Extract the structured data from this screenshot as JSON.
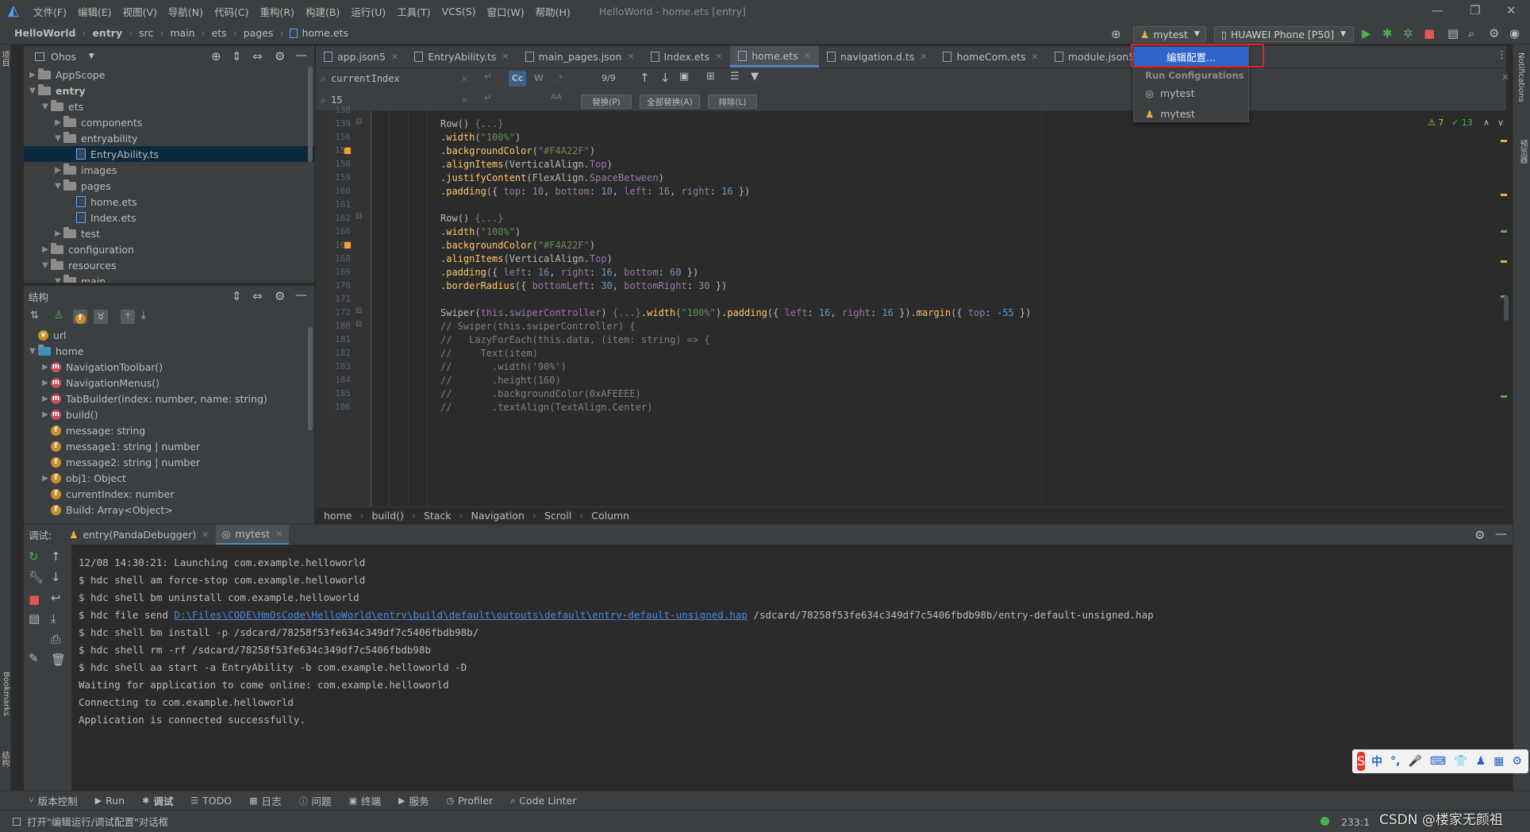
{
  "window": {
    "menus": [
      "文件(F)",
      "编辑(E)",
      "视图(V)",
      "导航(N)",
      "代码(C)",
      "重构(R)",
      "构建(B)",
      "运行(U)",
      "工具(T)",
      "VCS(S)",
      "窗口(W)",
      "帮助(H)"
    ],
    "title": "HelloWorld - home.ets [entry]"
  },
  "navbar": {
    "crumbs": [
      "HelloWorld",
      "entry",
      "src",
      "main",
      "ets",
      "pages",
      "home.ets"
    ],
    "run_config": "mytest",
    "device": "HUAWEI Phone [P50]"
  },
  "project": {
    "header": "Ohos",
    "tree": [
      {
        "label": "AppScope",
        "indent": 0,
        "kind": "folder",
        "open": false
      },
      {
        "label": "entry",
        "indent": 0,
        "kind": "folder",
        "open": true,
        "bold": true
      },
      {
        "label": "ets",
        "indent": 1,
        "kind": "folder",
        "open": true
      },
      {
        "label": "components",
        "indent": 2,
        "kind": "folder",
        "open": false
      },
      {
        "label": "entryability",
        "indent": 2,
        "kind": "folder",
        "open": true
      },
      {
        "label": "EntryAbility.ts",
        "indent": 3,
        "kind": "file",
        "selected": true
      },
      {
        "label": "images",
        "indent": 2,
        "kind": "folder",
        "open": false
      },
      {
        "label": "pages",
        "indent": 2,
        "kind": "folder",
        "open": true
      },
      {
        "label": "home.ets",
        "indent": 3,
        "kind": "file"
      },
      {
        "label": "Index.ets",
        "indent": 3,
        "kind": "file"
      },
      {
        "label": "test",
        "indent": 2,
        "kind": "folder",
        "open": false
      },
      {
        "label": "configuration",
        "indent": 1,
        "kind": "folder",
        "open": false
      },
      {
        "label": "resources",
        "indent": 1,
        "kind": "folder",
        "open": true
      },
      {
        "label": "main",
        "indent": 2,
        "kind": "folder",
        "open": true
      }
    ]
  },
  "structure": {
    "header": "结构",
    "tree": [
      {
        "label": "url",
        "indent": 0,
        "icon": "v",
        "arrow": false
      },
      {
        "label": "home",
        "indent": 0,
        "icon": "class",
        "arrow": true,
        "open": true
      },
      {
        "label": "NavigationToolbar()",
        "indent": 1,
        "icon": "m",
        "arrow": true
      },
      {
        "label": "NavigationMenus()",
        "indent": 1,
        "icon": "m",
        "arrow": true
      },
      {
        "label": "TabBuilder(index: number, name: string)",
        "indent": 1,
        "icon": "m",
        "arrow": true
      },
      {
        "label": "build()",
        "indent": 1,
        "icon": "m",
        "arrow": true
      },
      {
        "label": "message: string",
        "indent": 1,
        "icon": "f",
        "arrow": false
      },
      {
        "label": "message1: string | number",
        "indent": 1,
        "icon": "f",
        "arrow": false
      },
      {
        "label": "message2: string | number",
        "indent": 1,
        "icon": "f",
        "arrow": false
      },
      {
        "label": "obj1: Object",
        "indent": 1,
        "icon": "f",
        "arrow": true
      },
      {
        "label": "currentIndex: number",
        "indent": 1,
        "icon": "f",
        "arrow": false
      },
      {
        "label": "Build: Array<Object>",
        "indent": 1,
        "icon": "f",
        "arrow": false
      }
    ]
  },
  "tabs": [
    {
      "label": "app.json5"
    },
    {
      "label": "EntryAbility.ts"
    },
    {
      "label": "main_pages.json"
    },
    {
      "label": "Index.ets"
    },
    {
      "label": "home.ets",
      "active": true
    },
    {
      "label": "navigation.d.ts"
    },
    {
      "label": "homeCom.ets"
    },
    {
      "label": "module.json5"
    }
  ],
  "find": {
    "search_value": "currentIndex",
    "count": "9/9",
    "replace_value": "15",
    "cc": "Cc",
    "w": "W",
    "regex": ".*",
    "aa": "AA",
    "btn_replace": "替换(P)",
    "btn_replace_all": "全部替换(A)",
    "btn_exclude": "排除(L)"
  },
  "editor": {
    "warnings": "7",
    "weak_warnings": "13",
    "lines": [
      {
        "n": "138",
        "html": ""
      },
      {
        "n": "139",
        "html": "<span class='ty'>Row</span>() <span class='cmt'>{...}</span>"
      },
      {
        "n": "156",
        "html": "<span class='fn'>.width</span>(<span class='str'>\"100%\"</span>)"
      },
      {
        "n": "157",
        "html": "<span class='fn'>.backgroundColor</span>(<span class='str'>\"#F4A22F\"</span>)"
      },
      {
        "n": "158",
        "html": "<span class='fn'>.alignItems</span>(<span class='ty'>VerticalAlign</span>.<span class='prop'>Top</span>)"
      },
      {
        "n": "159",
        "html": "<span class='fn'>.justifyContent</span>(<span class='ty'>FlexAlign</span>.<span class='prop'>SpaceBetween</span>)"
      },
      {
        "n": "160",
        "html": "<span class='fn'>.padding</span>({ <span class='prop'>top</span>: <span class='num'>10</span>, <span class='prop'>bottom</span>: <span class='num'>10</span>, <span class='prop'>left</span>: <span class='num'>16</span>, <span class='prop'>right</span>: <span class='num'>16</span> })"
      },
      {
        "n": "161",
        "html": ""
      },
      {
        "n": "162",
        "html": "<span class='ty'>Row</span>() <span class='cmt'>{...}</span>"
      },
      {
        "n": "166",
        "html": "<span class='fn'>.width</span>(<span class='str'>\"100%\"</span>)"
      },
      {
        "n": "167",
        "html": "<span class='fn'>.backgroundColor</span>(<span class='str'>\"#F4A22F\"</span>)"
      },
      {
        "n": "168",
        "html": "<span class='fn'>.alignItems</span>(<span class='ty'>VerticalAlign</span>.<span class='prop'>Top</span>)"
      },
      {
        "n": "169",
        "html": "<span class='fn'>.padding</span>({ <span class='prop'>left</span>: <span class='num'>16</span>, <span class='prop'>right</span>: <span class='num'>16</span>, <span class='prop'>bottom</span>: <span class='num'>60</span> })"
      },
      {
        "n": "170",
        "html": "<span class='fn'>.borderRadius</span>({ <span class='prop'>bottomLeft</span>: <span class='num'>30</span>, <span class='prop'>bottomRight</span>: <span class='num'>30</span> })"
      },
      {
        "n": "171",
        "html": ""
      },
      {
        "n": "172",
        "html": "<span class='ty'>Swiper</span>(<span class='prop'>this</span>.<span class='prop'>swiperController</span>) <span class='cmt'>{...}</span><span class='fn'>.width</span>(<span class='str'>\"100%\"</span>)<span class='fn'>.padding</span>({ <span class='prop'>left</span>: <span class='num'>16</span>, <span class='prop'>right</span>: <span class='num'>16</span> })<span class='fn'>.margin</span>({ <span class='prop'>top</span>: <span class='num'>-55</span> })"
      },
      {
        "n": "180",
        "html": "<span class='cmt'>// Swiper(this.swiperController) {</span>"
      },
      {
        "n": "181",
        "html": "<span class='cmt'>//   LazyForEach(this.data, (item: string) =&gt; {</span>"
      },
      {
        "n": "182",
        "html": "<span class='cmt'>//     Text(item)</span>"
      },
      {
        "n": "183",
        "html": "<span class='cmt'>//       .width('90%')</span>"
      },
      {
        "n": "184",
        "html": "<span class='cmt'>//       .height(160)</span>"
      },
      {
        "n": "185",
        "html": "<span class='cmt'>//       .backgroundColor(0xAFEEEE)</span>"
      },
      {
        "n": "186",
        "html": "<span class='cmt'>//       .textAlign(TextAlign.Center)</span>"
      }
    ],
    "breadcrumbs": [
      "home",
      "build()",
      "Stack",
      "Navigation",
      "Scroll",
      "Column"
    ]
  },
  "debug": {
    "label": "调试:",
    "tabs": [
      {
        "label": "entry(PandaDebugger)"
      },
      {
        "label": "mytest",
        "active": true
      }
    ],
    "console": [
      "12/08 14:30:21: Launching com.example.helloworld",
      "$ hdc shell am force-stop com.example.helloworld",
      "$ hdc shell bm uninstall com.example.helloworld",
      {
        "pre": "$ hdc file send ",
        "link": "D:\\Files\\CODE\\HmOsCode\\HelloWorld\\entry\\build\\default\\outputs\\default\\entry-default-unsigned.hap",
        "post": " /sdcard/78258f53fe634c349df7c5406fbdb98b/entry-default-unsigned.hap"
      },
      "$ hdc shell bm install -p /sdcard/78258f53fe634c349df7c5406fbdb98b/",
      "$ hdc shell rm -rf /sdcard/78258f53fe634c349df7c5406fbdb98b",
      "$ hdc shell aa start -a EntryAbility -b com.example.helloworld -D",
      "Waiting for application to come online: com.example.helloworld",
      "Connecting to com.example.helloworld",
      "Application is connected successfully."
    ]
  },
  "bottom_tools": [
    "版本控制",
    "Run",
    "调试",
    "TODO",
    "日志",
    "问题",
    "终端",
    "服务",
    "Profiler",
    "Code Linter"
  ],
  "status": {
    "message": "打开\"编辑运行/调试配置\"对话框",
    "position": "233:1"
  },
  "run_menu": {
    "edit": "编辑配置...",
    "section": "Run Configurations",
    "items": [
      "mytest",
      "mytest"
    ]
  },
  "left_strip": [
    "项目",
    "Bookmarks",
    "结构"
  ],
  "right_strip": [
    "Notifications",
    "预览器"
  ],
  "ime": [
    "中",
    "°,",
    "🎤",
    "⌨",
    "👕",
    "♟",
    "▦",
    "⚙"
  ],
  "watermark": "CSDN @楼家无颜祖"
}
